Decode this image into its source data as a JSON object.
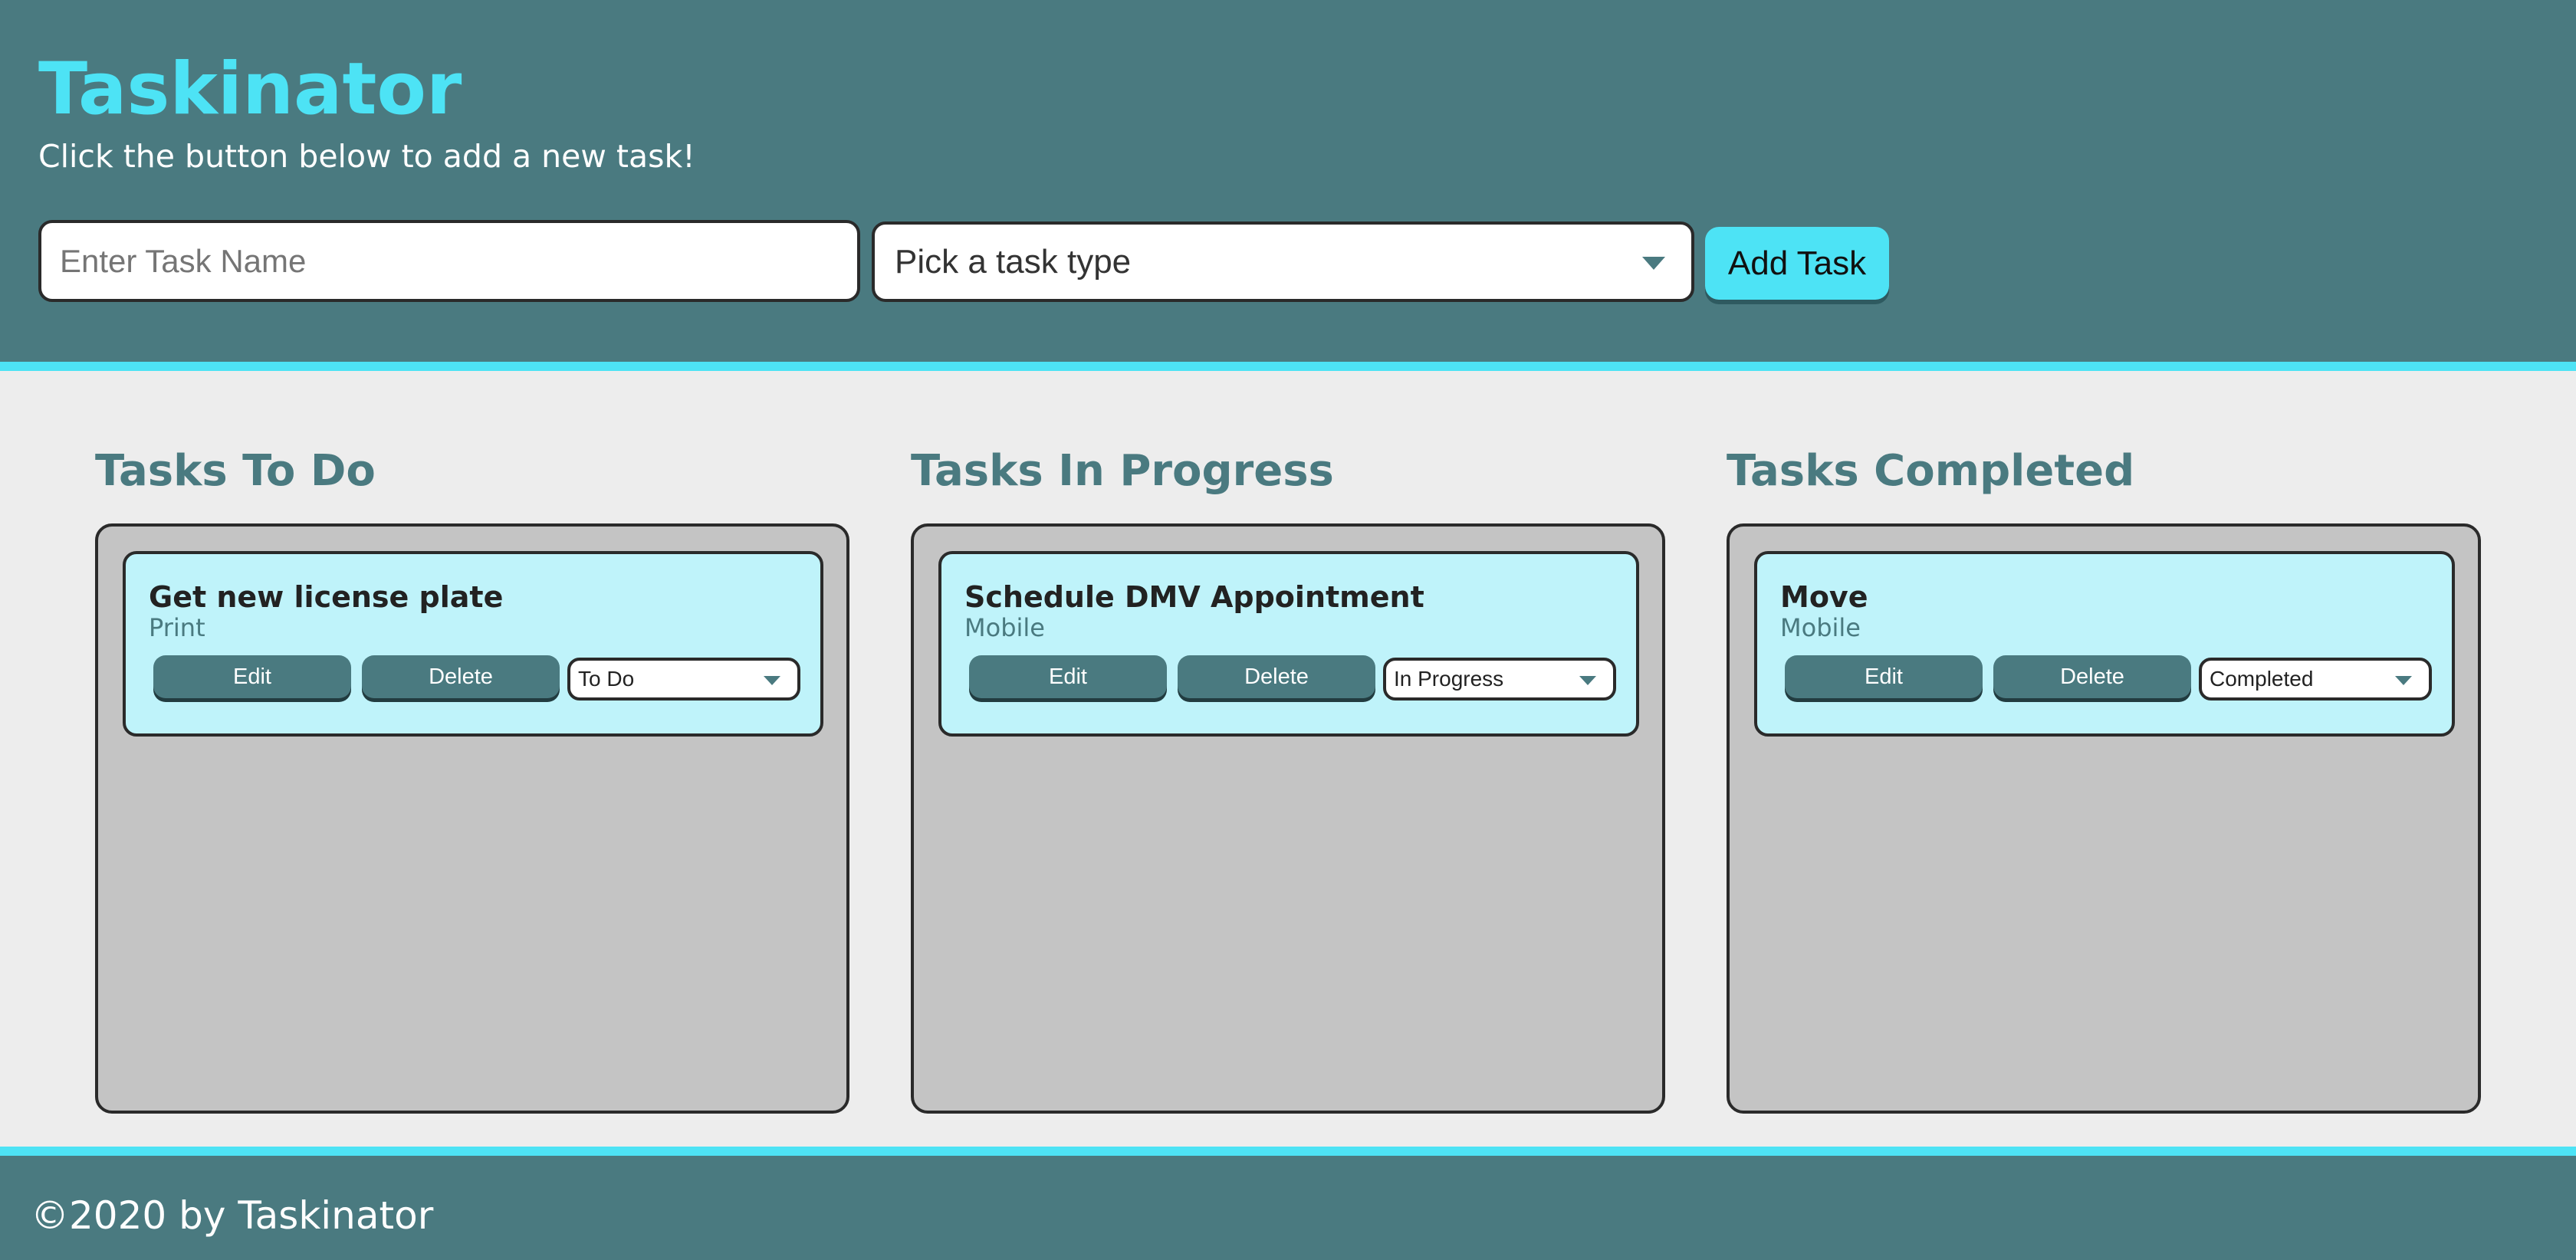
{
  "header": {
    "title": "Taskinator",
    "subtitle": "Click the button below to add a new task!",
    "task_name_placeholder": "Enter Task Name",
    "task_type_selected": "Pick a task type",
    "add_task_label": "Add Task"
  },
  "columns": [
    {
      "title": "Tasks To Do",
      "tasks": [
        {
          "name": "Get new license plate",
          "type": "Print",
          "edit_label": "Edit",
          "delete_label": "Delete",
          "status": "To Do"
        }
      ]
    },
    {
      "title": "Tasks In Progress",
      "tasks": [
        {
          "name": "Schedule DMV Appointment",
          "type": "Mobile",
          "edit_label": "Edit",
          "delete_label": "Delete",
          "status": "In Progress"
        }
      ]
    },
    {
      "title": "Tasks Completed",
      "tasks": [
        {
          "name": "Move",
          "type": "Mobile",
          "edit_label": "Edit",
          "delete_label": "Delete",
          "status": "Completed"
        }
      ]
    }
  ],
  "footer": {
    "copyright": "©2020 by Taskinator"
  },
  "colors": {
    "primary": "#4a7a80",
    "accent": "#4de3f5",
    "card": "#bff3fa",
    "list_bg": "#c4c4c4",
    "page_bg": "#ededed"
  },
  "icons": {
    "select_caret": "chevron-down-icon"
  }
}
